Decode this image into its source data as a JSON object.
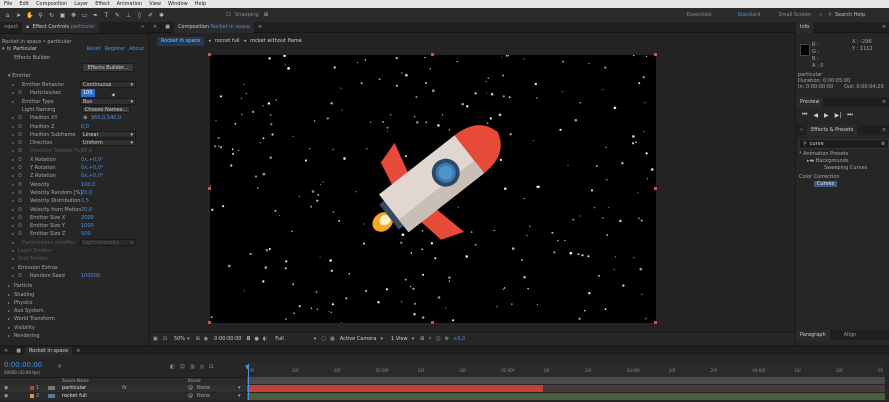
{
  "menu": [
    "File",
    "Edit",
    "Composition",
    "Layer",
    "Effect",
    "Animation",
    "View",
    "Window",
    "Help"
  ],
  "toolbar": {
    "snapping": "Snapping",
    "workspaces": [
      "Essentials",
      "Standard",
      "Small Screen"
    ],
    "active_workspace": "Standard",
    "search_placeholder": "Search Help"
  },
  "left_panel": {
    "tab_project": "roject",
    "tab_effect_controls_prefix": "Effect Controls",
    "tab_effect_controls_layer": "particular",
    "breadcrumb": "Rocket in space • particular",
    "effect_name": "Particular",
    "reset": "Reset",
    "register": "Register",
    "about": "About",
    "effects_builder_label": "Effects Builder",
    "effects_builder_button": "Effects Builder...",
    "emitter_group": "Emitter",
    "rows": [
      {
        "label": "Emitter Behavior",
        "value": "Continuous",
        "kind": "dropdown",
        "indent": 22
      },
      {
        "label": "Particles/sec",
        "value": "100",
        "kind": "selected",
        "indent": 22,
        "sw": true
      },
      {
        "label": "Emitter Type",
        "value": "Box",
        "kind": "dropdown",
        "indent": 22
      },
      {
        "label": "Light Naming",
        "value": "Choose Names...",
        "kind": "button",
        "indent": 22
      },
      {
        "label": "Position XY",
        "value": "960,0,540,0",
        "kind": "blue",
        "indent": 22,
        "sw": true
      },
      {
        "label": "Position Z",
        "value": "0,0",
        "kind": "blue",
        "indent": 22,
        "sw": true
      },
      {
        "label": "Position Subframe",
        "value": "Linear",
        "kind": "dropdown",
        "indent": 22,
        "sw": true
      },
      {
        "label": "Direction",
        "value": "Uniform",
        "kind": "dropdown",
        "indent": 22,
        "sw": true
      },
      {
        "label": "Direction Spread [%]",
        "value": "20,0",
        "kind": "dim",
        "indent": 22,
        "sw": true
      },
      {
        "label": "X Rotation",
        "value": "0x,+0,0°",
        "kind": "blue",
        "indent": 22,
        "sw": true
      },
      {
        "label": "Y Rotation",
        "value": "0x,+0,0°",
        "kind": "blue",
        "indent": 22,
        "sw": true
      },
      {
        "label": "Z Rotation",
        "value": "0x,+0,0°",
        "kind": "blue",
        "indent": 22,
        "sw": true
      },
      {
        "label": "Velocity",
        "value": "100,0",
        "kind": "blue",
        "indent": 22,
        "sw": true
      },
      {
        "label": "Velocity Random [%]",
        "value": "20,0",
        "kind": "blue",
        "indent": 22,
        "sw": true
      },
      {
        "label": "Velocity Distribution",
        "value": "0,5",
        "kind": "blue",
        "indent": 22,
        "sw": true
      },
      {
        "label": "Velocity from Motion",
        "value": "20,0",
        "kind": "blue",
        "indent": 22,
        "sw": true
      },
      {
        "label": "Emitter Size X",
        "value": "2000",
        "kind": "blue",
        "indent": 22,
        "sw": true
      },
      {
        "label": "Emitter Size Y",
        "value": "1000",
        "kind": "blue",
        "indent": 22,
        "sw": true
      },
      {
        "label": "Emitter Size Z",
        "value": "500",
        "kind": "blue",
        "indent": 22,
        "sw": true
      },
      {
        "label": "Particles/sec modifier",
        "value": "Light Intensity",
        "kind": "dimdrop",
        "indent": 22
      },
      {
        "label": "Layer Emitter",
        "value": "",
        "kind": "dimgroup",
        "indent": 18
      },
      {
        "label": "Grid Emitter",
        "value": "",
        "kind": "dimgroup",
        "indent": 18
      },
      {
        "label": "Emission Extras",
        "value": "",
        "kind": "group",
        "indent": 18
      },
      {
        "label": "Random Seed",
        "value": "100000",
        "kind": "blue",
        "indent": 22,
        "sw": true
      }
    ],
    "groups": [
      "Particle",
      "Shading",
      "Physics",
      "Aux System",
      "World Transform",
      "Visibility",
      "Rendering"
    ]
  },
  "comp": {
    "tab_prefix": "Composition",
    "tab_name": "Rocket in space",
    "subtabs": [
      "Rocket in space",
      "roccet full",
      "rocket without flame"
    ],
    "footer": {
      "zoom": "50%",
      "timecode": "0:00:00:00",
      "resolution": "Full",
      "camera": "Active Camera",
      "view": "1 View",
      "exposure": "+0,0"
    }
  },
  "right_panel": {
    "info_tab": "Info",
    "info_values": {
      "r": "R :",
      "g": "G :",
      "b": "B :",
      "a": "A : 0",
      "x": "X : -296",
      "y": "Y : 1112"
    },
    "layer_name": "particular",
    "duration": "Duration: 0:00:05:00",
    "in_point": "In: 0:00:00:00",
    "out_point": "Out: 0:00:04:29",
    "preview_tab": "Preview",
    "effects_tab": "Effects & Presets",
    "search_value": "curve",
    "tree": [
      "* Animation Presets",
      "Backgrounds",
      "Sweeping Curves",
      "Color Correction",
      "Curves"
    ],
    "paragraph_tab": "Paragraph",
    "align_tab": "Align"
  },
  "timeline": {
    "tab": "Rocket in space",
    "timecode": "0:00:00:00",
    "fps": "00000 (30.00 fps)",
    "col_source": "Source Name",
    "col_parent": "Parent",
    "layers": [
      {
        "num": "1",
        "name": "particular",
        "parent": "None"
      },
      {
        "num": "2",
        "name": "rocket full",
        "parent": "None"
      }
    ],
    "ticks": [
      "0f",
      "10f",
      "20f",
      "01:00f",
      "10f",
      "20f",
      "02:00f",
      "10f",
      "20f",
      "03:00f",
      "10f",
      "20f",
      "04:00f",
      "10f",
      "20f",
      "05"
    ]
  },
  "colors": {
    "accent": "#4a90e2",
    "rocket_body": "#e0d8d0",
    "rocket_red": "#e84a3a",
    "window_blue": "#3a7ab0",
    "flame": "#f5a623",
    "layer_bar": "#c0433a"
  }
}
